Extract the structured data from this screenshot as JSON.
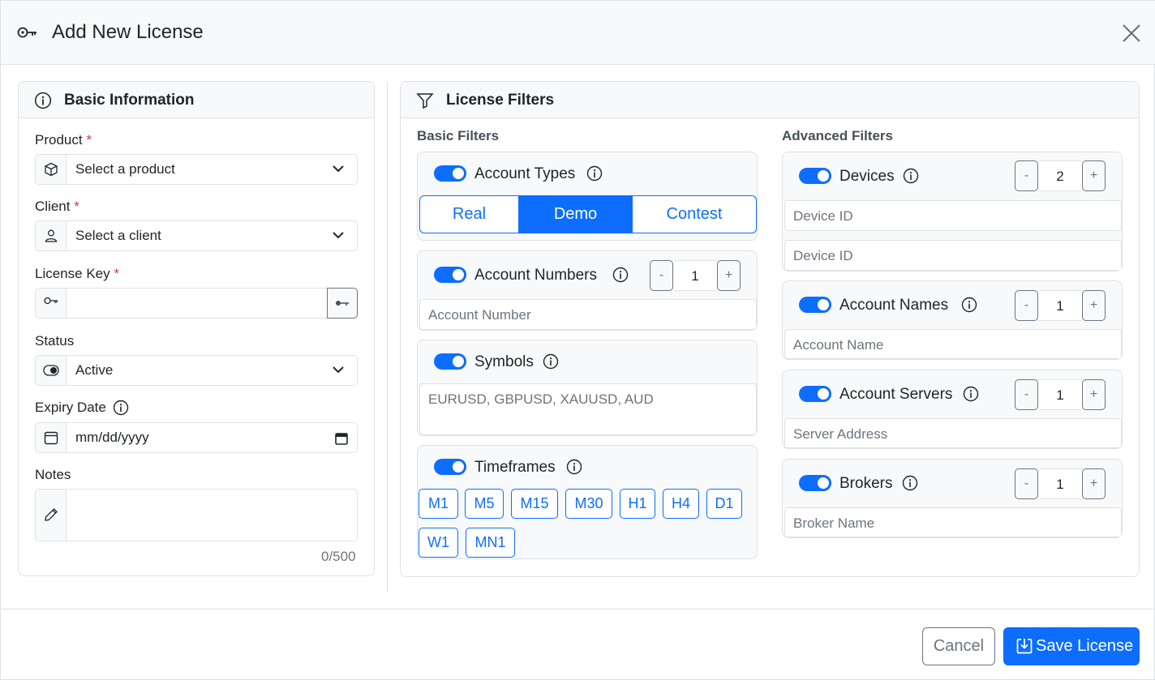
{
  "dialog": {
    "title": "Add New License",
    "close_label": "×"
  },
  "basic": {
    "title": "Basic Information",
    "product": {
      "label": "Product",
      "req": "*",
      "value": "Select a product"
    },
    "client": {
      "label": "Client",
      "req": "*",
      "value": "Select a client"
    },
    "license_key": {
      "label": "License Key",
      "req": "*",
      "value": ""
    },
    "status": {
      "label": "Status",
      "value": "Active"
    },
    "expiry": {
      "label": "Expiry Date",
      "placeholder": "mm/dd/yyyy"
    },
    "notes": {
      "label": "Notes",
      "value": "",
      "counter": "0/500"
    }
  },
  "filters": {
    "title": "License Filters",
    "basic_label": "Basic Filters",
    "advanced_label": "Advanced Filters",
    "account_types": {
      "label": "Account Types",
      "options": [
        "Real",
        "Demo",
        "Contest"
      ],
      "selected": "Demo"
    },
    "account_numbers": {
      "label": "Account Numbers",
      "count": "1",
      "placeholder": "Account Number"
    },
    "symbols": {
      "label": "Symbols",
      "placeholder": "EURUSD, GBPUSD, XAUUSD, AUD"
    },
    "timeframes": {
      "label": "Timeframes",
      "options": [
        "M1",
        "M5",
        "M15",
        "M30",
        "H1",
        "H4",
        "D1",
        "W1",
        "MN1"
      ]
    },
    "devices": {
      "label": "Devices",
      "count": "2",
      "placeholders": [
        "Device ID",
        "Device ID"
      ]
    },
    "account_names": {
      "label": "Account Names",
      "count": "1",
      "placeholder": "Account Name"
    },
    "account_servers": {
      "label": "Account Servers",
      "count": "1",
      "placeholder": "Server Address"
    },
    "brokers": {
      "label": "Brokers",
      "count": "1",
      "placeholder": "Broker Name"
    },
    "minus": "-",
    "plus": "+"
  },
  "footer": {
    "cancel": "Cancel",
    "save": "Save License"
  },
  "colors": {
    "primary": "#0d6efd",
    "required": "#dc3545",
    "border": "#dee2e6"
  }
}
